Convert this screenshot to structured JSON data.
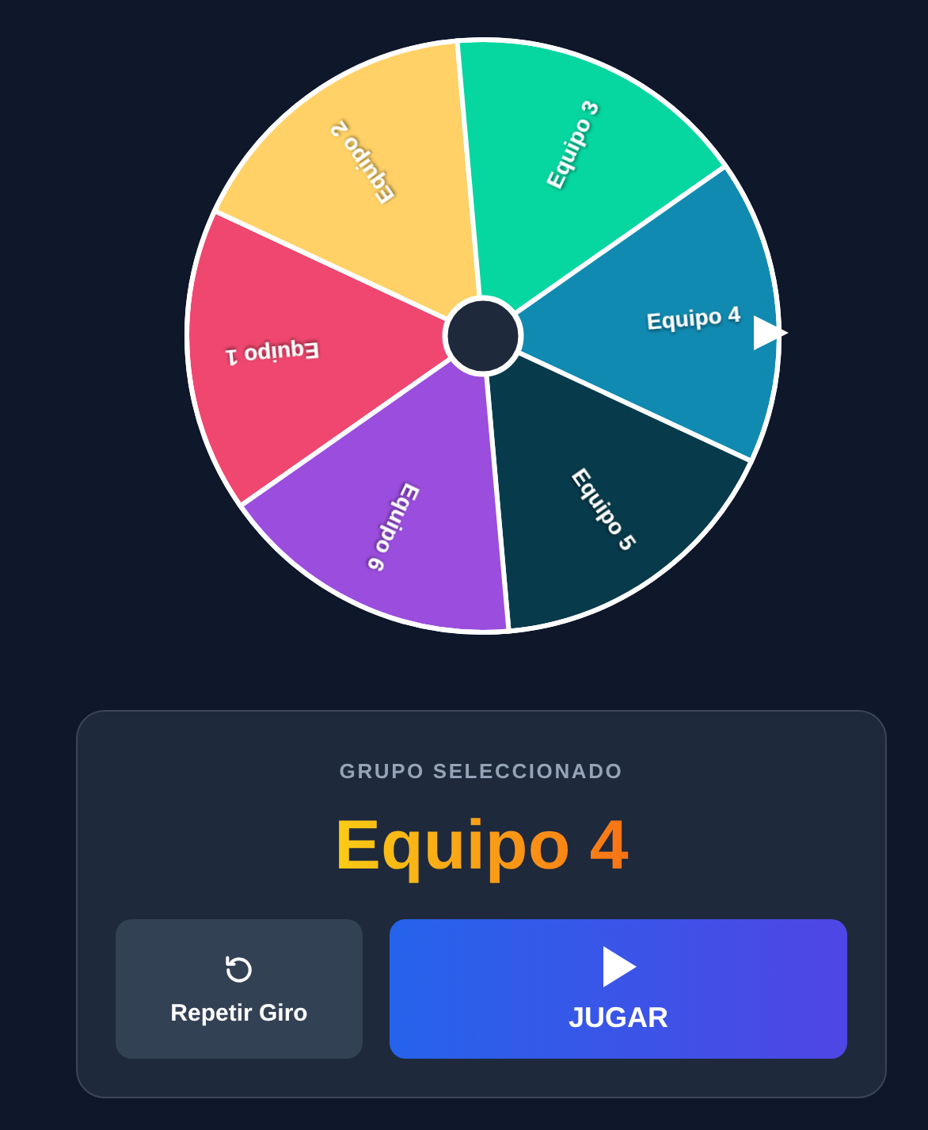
{
  "wheel": {
    "segments": [
      {
        "label": "Equipo 1",
        "color": "#ef476f"
      },
      {
        "label": "Equipo 2",
        "color": "#ffd166"
      },
      {
        "label": "Equipo 3",
        "color": "#06d6a0"
      },
      {
        "label": "Equipo 4",
        "color": "#118ab2"
      },
      {
        "label": "Equipo 5",
        "color": "#073b4c"
      },
      {
        "label": "Equipo 6",
        "color": "#9b4dde"
      }
    ]
  },
  "result": {
    "caption": "GRUPO SELECCIONADO",
    "value": "Equipo 4"
  },
  "buttons": [
    {
      "kind": "respin",
      "label": "Repetir Giro"
    },
    {
      "kind": "play",
      "label": "JUGAR"
    }
  ]
}
